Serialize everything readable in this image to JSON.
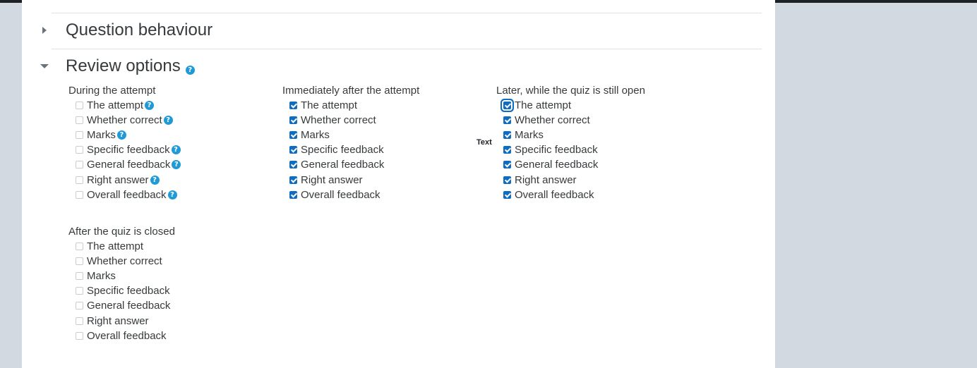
{
  "sections": {
    "question_behaviour": {
      "title": "Question behaviour",
      "expanded": false
    },
    "review_options": {
      "title": "Review options",
      "expanded": true,
      "help_icon": "question-circle-icon"
    }
  },
  "floating_label": "Text",
  "columns": [
    {
      "title": "During the attempt",
      "options": [
        {
          "label": "The attempt",
          "checked": false,
          "help": true
        },
        {
          "label": "Whether correct",
          "checked": false,
          "help": true
        },
        {
          "label": "Marks",
          "checked": false,
          "help": true
        },
        {
          "label": "Specific feedback",
          "checked": false,
          "help": true
        },
        {
          "label": "General feedback",
          "checked": false,
          "help": true
        },
        {
          "label": "Right answer",
          "checked": false,
          "help": true
        },
        {
          "label": "Overall feedback",
          "checked": false,
          "help": true
        }
      ]
    },
    {
      "title": "Immediately after the attempt",
      "options": [
        {
          "label": "The attempt",
          "checked": true
        },
        {
          "label": "Whether correct",
          "checked": true
        },
        {
          "label": "Marks",
          "checked": true
        },
        {
          "label": "Specific feedback",
          "checked": true
        },
        {
          "label": "General feedback",
          "checked": true
        },
        {
          "label": "Right answer",
          "checked": true
        },
        {
          "label": "Overall feedback",
          "checked": true
        }
      ]
    },
    {
      "title": "Later, while the quiz is still open",
      "options": [
        {
          "label": "The attempt",
          "checked": true,
          "focused": true
        },
        {
          "label": "Whether correct",
          "checked": true
        },
        {
          "label": "Marks",
          "checked": true
        },
        {
          "label": "Specific feedback",
          "checked": true
        },
        {
          "label": "General feedback",
          "checked": true
        },
        {
          "label": "Right answer",
          "checked": true
        },
        {
          "label": "Overall feedback",
          "checked": true
        }
      ]
    },
    {
      "title": "After the quiz is closed",
      "options": [
        {
          "label": "The attempt",
          "checked": false
        },
        {
          "label": "Whether correct",
          "checked": false
        },
        {
          "label": "Marks",
          "checked": false
        },
        {
          "label": "Specific feedback",
          "checked": false
        },
        {
          "label": "General feedback",
          "checked": false
        },
        {
          "label": "Right answer",
          "checked": false
        },
        {
          "label": "Overall feedback",
          "checked": false
        }
      ]
    }
  ]
}
